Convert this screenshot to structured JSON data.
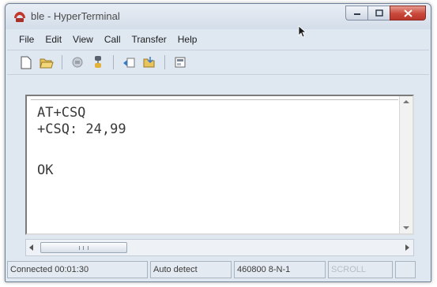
{
  "window": {
    "title": "ble - HyperTerminal",
    "title_icon": "hyperterminal-phone-icon"
  },
  "menu": [
    "File",
    "Edit",
    "View",
    "Call",
    "Transfer",
    "Help"
  ],
  "toolbar": {
    "buttons": [
      "new-connection-icon",
      "open-icon",
      "call-icon",
      "disconnect-icon",
      "send-icon",
      "receive-icon",
      "properties-icon"
    ]
  },
  "terminal": {
    "lines": [
      "AT+CSQ",
      "+CSQ: 24,99",
      "OK"
    ]
  },
  "hscroll": {
    "thumb_fraction": 0.22
  },
  "statusbar": {
    "connected": "Connected 00:01:30",
    "detect": "Auto detect",
    "port_settings": "460800 8-N-1",
    "scroll": "SCROLL"
  },
  "colors": {
    "close_button": "#c9493b",
    "terminal_text": "#3a3a3a"
  }
}
